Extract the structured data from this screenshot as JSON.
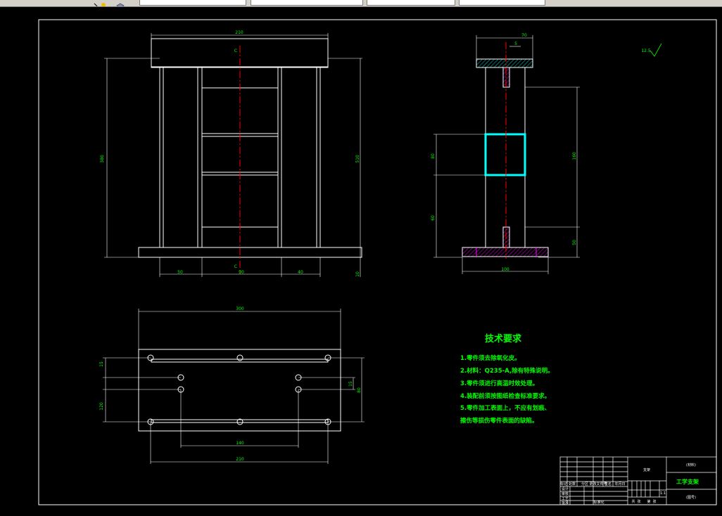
{
  "toolbar": {
    "fields": [
      "",
      "",
      "",
      ""
    ],
    "colors": {
      "background": "#d4d0c8",
      "accent_yellow": "#e8c000"
    }
  },
  "drawing": {
    "colors": {
      "background": "#000000",
      "outline": "#ffffff",
      "dimension": "#00ff00",
      "centerline": "#ff0000",
      "section": "#00ffff",
      "hatch": "#ff00ff"
    },
    "front_view": {
      "dims": {
        "top_width": "210",
        "left_height": "380",
        "right_height": "510",
        "bottom_left": "50",
        "bottom_mid": "90",
        "bottom_right": "40",
        "bottom_edge": "10",
        "center_top": "C",
        "center_bottom": "C"
      }
    },
    "side_view": {
      "dims": {
        "top_width": "70",
        "flange": "5",
        "upper_height": "160",
        "box_height": "80",
        "lower_height": "60",
        "base_height": "50",
        "base_width": "100"
      }
    },
    "top_view": {
      "dims": {
        "overall_width": "300",
        "hole_span": "140",
        "bottom_width": "210",
        "left_top": "15",
        "left_main": "120",
        "right_small": "15",
        "right_large": "80"
      }
    },
    "roughness": {
      "label": "12.5"
    },
    "tech_requirements": {
      "title": "技术要求",
      "items": [
        "1.零件须去除氧化皮。",
        "2.材料：Q235-A,除有特殊说明。",
        "3.零件须进行高温时效处理。",
        "4.装配前须按图纸检查标准要求。",
        "5.零件加工表面上，不应有划痕、",
        "擦伤等损伤零件表面的缺陷。"
      ]
    },
    "title_block": {
      "part_name": "支架",
      "material": "(材料)",
      "company": "工学支架",
      "drawing_no": "(图号)",
      "scale": "1:1",
      "labels": [
        "标记",
        "处数",
        "分区",
        "更改文件号",
        "签名",
        "年月日",
        "设计",
        "审核",
        "工艺",
        "标准化",
        "批准"
      ],
      "bottom_row": [
        "共",
        "张",
        "第",
        "张"
      ]
    }
  }
}
